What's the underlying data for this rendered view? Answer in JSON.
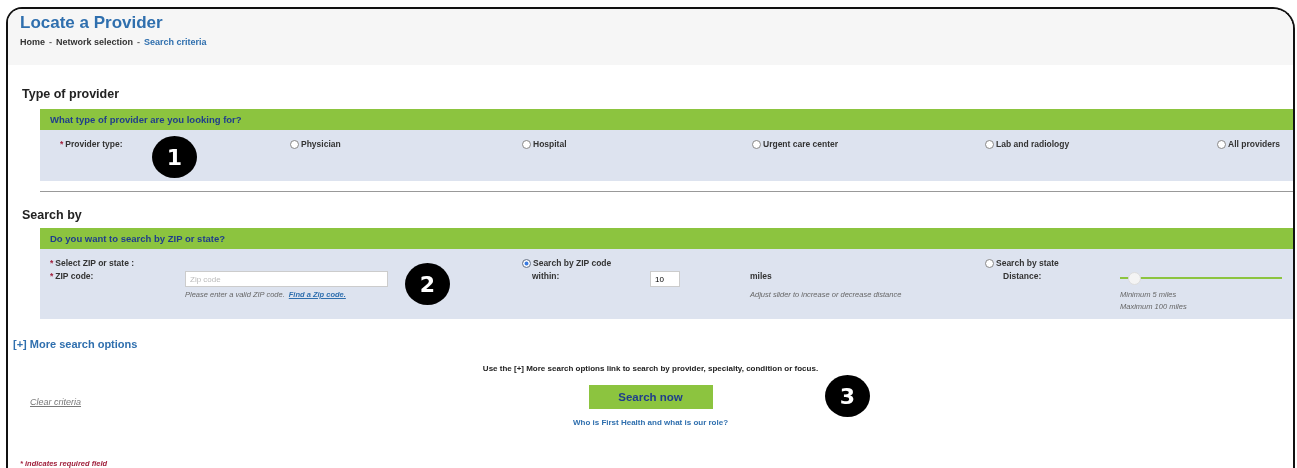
{
  "header": {
    "title": "Locate a Provider",
    "breadcrumbs": [
      {
        "label": "Home",
        "current": false
      },
      {
        "label": "Network selection",
        "current": false
      },
      {
        "label": "Search criteria",
        "current": true
      }
    ],
    "separator": "-"
  },
  "provider_section": {
    "heading": "Type of provider",
    "question": "What type of provider are you looking for?",
    "label": "Provider type:",
    "required_mark": "*",
    "callout": "1",
    "options": [
      {
        "label": "Physician",
        "selected": false
      },
      {
        "label": "Hospital",
        "selected": false
      },
      {
        "label": "Urgent care center",
        "selected": false
      },
      {
        "label": "Lab and radiology",
        "selected": false
      },
      {
        "label": "All providers",
        "selected": false
      }
    ]
  },
  "search_section": {
    "heading": "Search by",
    "question": "Do you want to search by ZIP or state?",
    "select_label": "Select ZIP or state :",
    "zip_label": "ZIP code:",
    "required_mark": "*",
    "zip_placeholder": "Zip code",
    "zip_hint": "Please enter a valid ZIP code.",
    "zip_link": "Find a Zip code.",
    "callout": "2",
    "modes": [
      {
        "label": "Search by ZIP code",
        "selected": true
      },
      {
        "label": "Search by state",
        "selected": false
      }
    ],
    "within_label": "within:",
    "within_value": "10",
    "miles": "miles",
    "slider_hint": "Adjust slider to increase or decrease distance",
    "distance_label": "Distance:",
    "distance": {
      "level": 0.05
    },
    "min_text": "Minimum 5 miles",
    "max_text": "Maximum 100 miles"
  },
  "more_options": "[+] More search options",
  "hint": "Use the [+] More search options link to search by provider, specialty, condition or focus.",
  "clear": "Clear criteria",
  "search_button": "Search now",
  "callout": "3",
  "about_link": "Who is First Health and what is our role?",
  "footnote": "* indicates required field"
}
